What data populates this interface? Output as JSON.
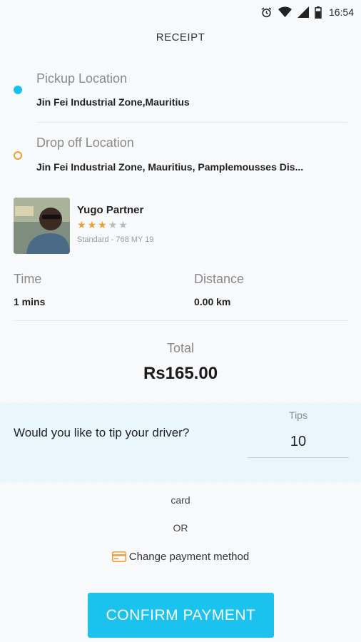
{
  "status_bar": {
    "time": "16:54"
  },
  "page_title": "RECEIPT",
  "pickup": {
    "label": "Pickup Location",
    "value": "Jin Fei Industrial Zone,Mauritius"
  },
  "dropoff": {
    "label": "Drop off Location",
    "value": "Jin Fei Industrial Zone, Mauritius, Pamplemousses Dis..."
  },
  "driver": {
    "name": "Yugo Partner",
    "rating": 3,
    "rating_max": 5,
    "vehicle": "Standard - 768 MY 19"
  },
  "metrics": {
    "time_label": "Time",
    "time_value": "1 mins",
    "distance_label": "Distance",
    "distance_value": "0.00 km"
  },
  "total": {
    "label": "Total",
    "value": "Rs165.00"
  },
  "tip": {
    "question": "Would you like to tip your driver?",
    "label": "Tips",
    "value": "10"
  },
  "payment": {
    "method": "card",
    "or": "OR",
    "change_label": "Change payment method",
    "confirm_label": "CONFIRM PAYMENT"
  },
  "colors": {
    "accent": "#1cc2ee",
    "pickup_dot": "#17c3ec",
    "dropoff_dot": "#f39c33",
    "star_on": "#f39c33",
    "tip_panel": "#e9f7fd"
  }
}
